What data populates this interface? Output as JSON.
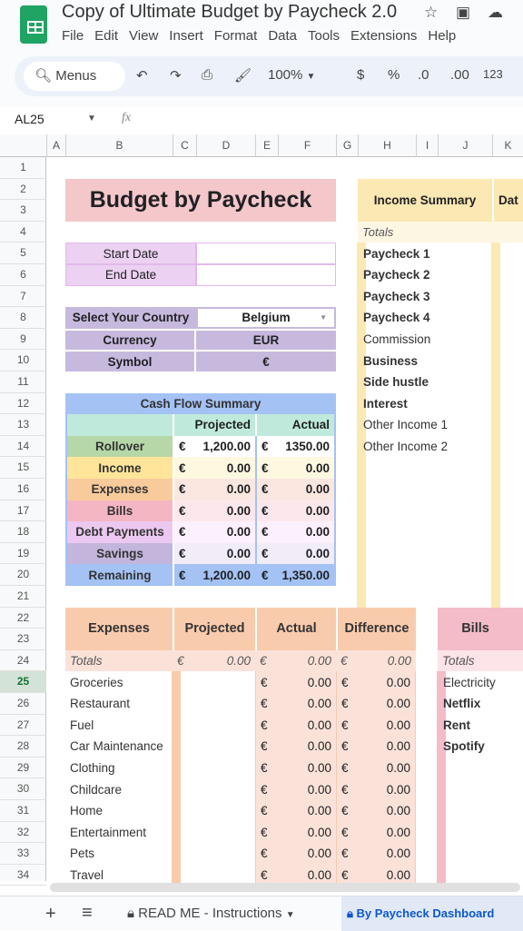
{
  "app": {
    "title": "Copy of Ultimate Budget by Paycheck 2.0",
    "menu": [
      "File",
      "Edit",
      "View",
      "Insert",
      "Format",
      "Data",
      "Tools",
      "Extensions",
      "Help"
    ],
    "search_label": "Menus",
    "zoom": "100%",
    "fmt": [
      "$",
      "%",
      ".0",
      ".00",
      "123"
    ],
    "cell_ref": "AL25",
    "fx": "fx"
  },
  "columns": [
    "A",
    "B",
    "C",
    "D",
    "E",
    "F",
    "G",
    "H",
    "I",
    "J",
    "K"
  ],
  "rows": [
    1,
    2,
    3,
    4,
    5,
    6,
    7,
    8,
    9,
    10,
    11,
    12,
    13,
    14,
    15,
    16,
    17,
    18,
    19,
    20,
    21,
    22,
    23,
    24,
    25,
    26,
    27,
    28,
    29,
    30,
    31,
    32,
    33,
    34
  ],
  "selected_row": 25,
  "sheet": {
    "title": "Budget by Paycheck",
    "start_date_label": "Start Date",
    "end_date_label": "End Date",
    "country_label": "Select Your Country",
    "country": "Belgium",
    "currency_label": "Currency",
    "currency": "EUR",
    "symbol_label": "Symbol",
    "symbol": "€",
    "cashflow": {
      "title": "Cash Flow Summary",
      "projected": "Projected",
      "actual": "Actual",
      "rows": [
        {
          "label": "Rollover",
          "projected": "1,200.00",
          "actual": "1350.00",
          "color": "#b6d7a8",
          "tint": "#ffffff"
        },
        {
          "label": "Income",
          "projected": "0.00",
          "actual": "0.00",
          "color": "#ffe599",
          "tint": "#fff8e1"
        },
        {
          "label": "Expenses",
          "projected": "0.00",
          "actual": "0.00",
          "color": "#f9cb9c",
          "tint": "#fbe7df"
        },
        {
          "label": "Bills",
          "projected": "0.00",
          "actual": "0.00",
          "color": "#f4b6c2",
          "tint": "#fce8ec"
        },
        {
          "label": "Debt Payments",
          "projected": "0.00",
          "actual": "0.00",
          "color": "#ecc8f0",
          "tint": "#fdf0fd"
        },
        {
          "label": "Savings",
          "projected": "0.00",
          "actual": "0.00",
          "color": "#c4b5dc",
          "tint": "#f1ecf8"
        },
        {
          "label": "Remaining",
          "projected": "1,200.00",
          "actual": "1,350.00",
          "color": "#a4c2f4",
          "tint": "#a4c2f4"
        }
      ]
    },
    "income": {
      "title": "Income Summary",
      "next_col": "Dat",
      "totals": "Totals",
      "items": [
        "Paycheck 1",
        "Paycheck 2",
        "Paycheck 3",
        "Paycheck 4",
        "Commission",
        "Business",
        "Side hustle",
        "Interest",
        "Other Income 1",
        "Other Income 2"
      ]
    },
    "expenses": {
      "headers": [
        "Expenses",
        "Projected",
        "Actual",
        "Difference"
      ],
      "totals": "Totals",
      "totals_values": [
        "0.00",
        "0.00",
        "0.00"
      ],
      "items": [
        {
          "name": "Groceries",
          "actual": "0.00",
          "diff": "0.00"
        },
        {
          "name": "Restaurant",
          "actual": "0.00",
          "diff": "0.00"
        },
        {
          "name": "Fuel",
          "actual": "0.00",
          "diff": "0.00"
        },
        {
          "name": "Car Maintenance",
          "actual": "0.00",
          "diff": "0.00"
        },
        {
          "name": "Clothing",
          "actual": "0.00",
          "diff": "0.00"
        },
        {
          "name": "Childcare",
          "actual": "0.00",
          "diff": "0.00"
        },
        {
          "name": "Home",
          "actual": "0.00",
          "diff": "0.00"
        },
        {
          "name": "Entertainment",
          "actual": "0.00",
          "diff": "0.00"
        },
        {
          "name": "Pets",
          "actual": "0.00",
          "diff": "0.00"
        },
        {
          "name": "Travel",
          "actual": "0.00",
          "diff": "0.00"
        }
      ]
    },
    "bills": {
      "title": "Bills",
      "totals": "Totals",
      "items": [
        "Electricity",
        "Netflix",
        "Rent",
        "Spotify"
      ]
    }
  },
  "tabs": {
    "add": "+",
    "all": "≡",
    "tab1": "READ ME - Instructions",
    "tab2": "By Paycheck Dashboard"
  }
}
